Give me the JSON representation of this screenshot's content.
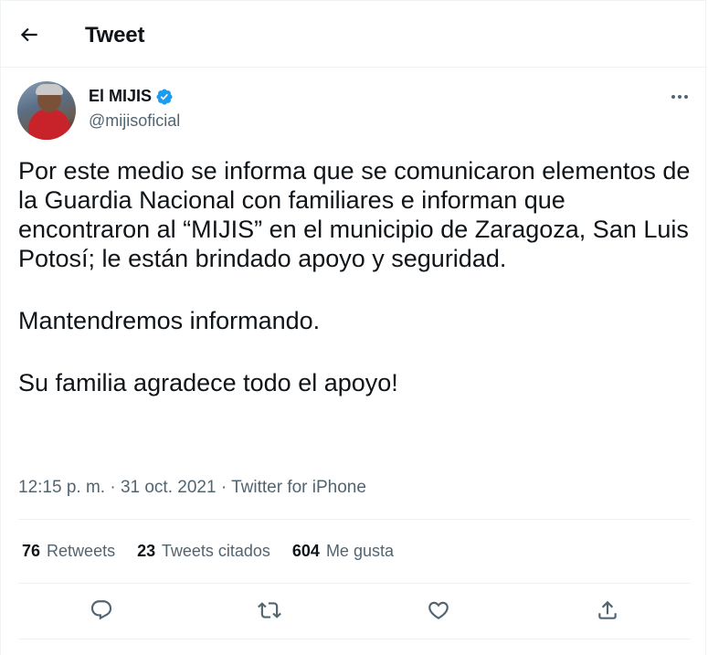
{
  "header": {
    "title": "Tweet"
  },
  "author": {
    "display_name": "El MIJIS",
    "handle": "@mijisoficial",
    "verified": true
  },
  "tweet": {
    "paragraphs": [
      "Por este medio se informa que se comunicaron elementos de la Guardia Nacional con familiares e informan que encontraron al “MIJIS” en el municipio de Zaragoza, San Luis Potosí; le están brindado apoyo y seguridad.",
      "Mantendremos informando.",
      "Su familia agradece todo el apoyo!"
    ]
  },
  "meta": {
    "time": "12:15 p. m.",
    "separator": " · ",
    "date": "31 oct. 2021",
    "source": "Twitter for iPhone"
  },
  "stats": {
    "retweets_count": "76",
    "retweets_label": "Retweets",
    "quotes_count": "23",
    "quotes_label": "Tweets citados",
    "likes_count": "604",
    "likes_label": "Me gusta"
  },
  "icons": {
    "back": "arrow-left-icon",
    "verified": "verified-badge-icon",
    "more": "more-horizontal-icon",
    "reply": "reply-icon",
    "retweet": "retweet-icon",
    "like": "heart-icon",
    "share": "share-icon"
  },
  "colors": {
    "text": "#0f1419",
    "secondary": "#536471",
    "verified_blue": "#1d9bf0",
    "border": "#eff3f4"
  }
}
